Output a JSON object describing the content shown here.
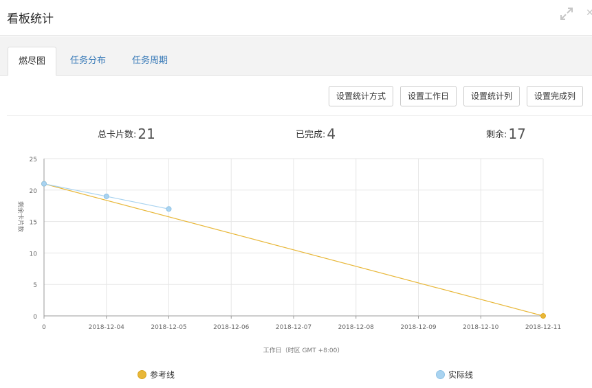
{
  "header": {
    "title": "看板统计"
  },
  "tabs": [
    {
      "label": "燃尽图",
      "active": true
    },
    {
      "label": "任务分布",
      "active": false
    },
    {
      "label": "任务周期",
      "active": false
    }
  ],
  "toolbar": {
    "buttons": [
      "设置统计方式",
      "设置工作日",
      "设置统计列",
      "设置完成列"
    ]
  },
  "stats": {
    "total_label": "总卡片数:",
    "total_value": "21",
    "done_label": "已完成:",
    "done_value": "4",
    "remaining_label": "剩余:",
    "remaining_value": "17"
  },
  "colors": {
    "reference": "#e8b738",
    "actual": "#a9d3f0",
    "tab_link": "#3a7bb8"
  },
  "chart_data": {
    "type": "line",
    "categories": [
      "0",
      "2018-12-04",
      "2018-12-05",
      "2018-12-06",
      "2018-12-07",
      "2018-12-08",
      "2018-12-09",
      "2018-12-10",
      "2018-12-11"
    ],
    "ylim": [
      0,
      25
    ],
    "yticks": [
      0,
      5,
      10,
      15,
      20,
      25
    ],
    "ylabel": "剩余卡片数",
    "xlabel": "工作日（时区 GMT +8:00）",
    "grid": true,
    "legend_position": "bottom",
    "series": [
      {
        "name": "参考线",
        "color": "#e8b738",
        "values": [
          21,
          null,
          null,
          null,
          null,
          null,
          null,
          null,
          0
        ]
      },
      {
        "name": "实际线",
        "color": "#a9d3f0",
        "values": [
          21,
          19,
          17,
          null,
          null,
          null,
          null,
          null,
          null
        ]
      }
    ]
  }
}
